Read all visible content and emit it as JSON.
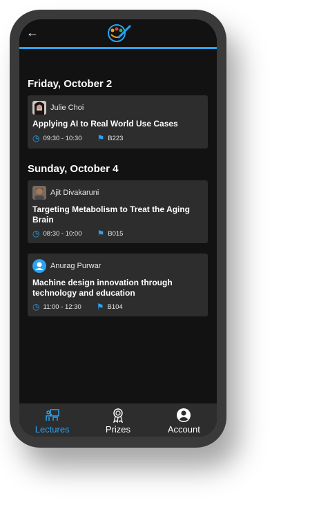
{
  "app": {
    "logo": "hands-check-logo",
    "back_icon": "arrow-left-icon"
  },
  "colors": {
    "accent": "#2aa3f0",
    "background": "#121212",
    "card": "#2d2d2d"
  },
  "days": [
    {
      "label": "Friday, October 2",
      "lectures": [
        {
          "speaker": "Julie Choi",
          "title": "Applying AI to Real World Use Cases",
          "time": "09:30 - 10:30",
          "room": "B223"
        }
      ]
    },
    {
      "label": "Sunday, October 4",
      "lectures": [
        {
          "speaker": "Ajit Divakaruni",
          "title": "Targeting Metabolism to Treat the Aging Brain",
          "time": "08:30 - 10:00",
          "room": "B015"
        },
        {
          "speaker": "Anurag Purwar",
          "title": "Machine design innovation through technology and education",
          "time": "11:00 - 12:30",
          "room": "B104"
        }
      ]
    }
  ],
  "nav": [
    {
      "label": "Lectures",
      "icon": "lecture-icon",
      "active": true
    },
    {
      "label": "Prizes",
      "icon": "award-icon",
      "active": false
    },
    {
      "label": "Account",
      "icon": "account-icon",
      "active": false
    }
  ]
}
